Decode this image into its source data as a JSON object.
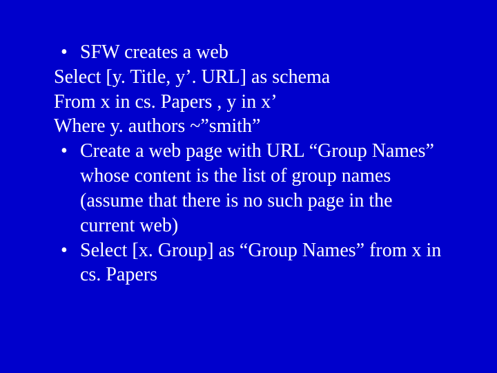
{
  "slide": {
    "bullets": [
      {
        "lead": "SFW creates a web",
        "sub": [
          "Select [y. Title, y’. URL] as schema",
          "From x in cs. Papers , y in x’",
          "Where y. authors ~”smith”"
        ]
      },
      {
        "lead": "Create a web page with URL “Group Names” whose content is the list of group names (assume that there is no such page in the current web)",
        "sub": []
      },
      {
        "lead": "Select [x. Group] as “Group Names” from x in cs. Papers",
        "sub": []
      }
    ]
  },
  "glyphs": {
    "bullet": "•"
  }
}
